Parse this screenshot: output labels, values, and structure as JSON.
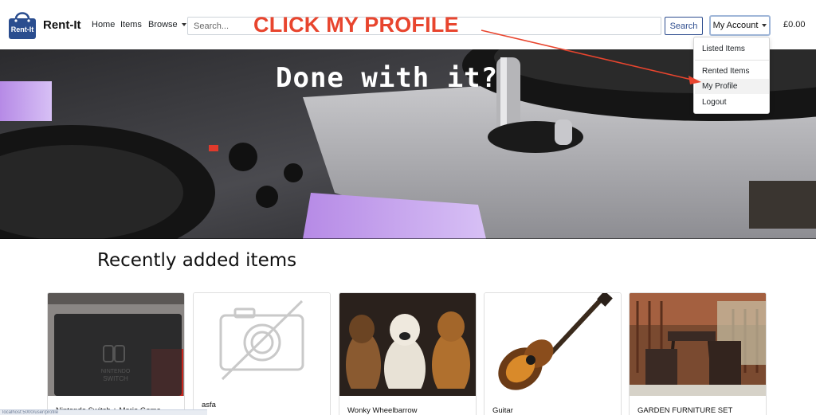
{
  "brand": {
    "name": "Rent-It",
    "logo_text": "Rent-It"
  },
  "nav": {
    "home": "Home",
    "items": "Items",
    "browse": "Browse"
  },
  "search": {
    "placeholder": "Search...",
    "button_label": "Search"
  },
  "account": {
    "button_label": "My Account",
    "menu": [
      "Listed Items",
      "Rented Items",
      "My Profile",
      "Logout"
    ]
  },
  "cart": {
    "total": "£0.00"
  },
  "hero": {
    "title": "Done with it?"
  },
  "annotation": {
    "text": "CLICK MY PROFILE"
  },
  "section": {
    "title": "Recently added items"
  },
  "cards": [
    {
      "title": "Nintendo Switch + Mario Game",
      "image": "nintendo-switch-photo"
    },
    {
      "title": "asfa",
      "image": "no-image-placeholder"
    },
    {
      "title": "Wonky Wheelbarrow",
      "image": "three-dogs-photo"
    },
    {
      "title": "Guitar",
      "image": "acoustic-guitar-photo"
    },
    {
      "title": "GARDEN FURNITURE SET",
      "image": "garden-furniture-photo"
    }
  ],
  "statusbar": {
    "text": "localhost:5000/user/profile"
  },
  "colors": {
    "accent": "#2f4e8f",
    "annotation": "#e8452e",
    "logo": "#2a4d8f"
  }
}
